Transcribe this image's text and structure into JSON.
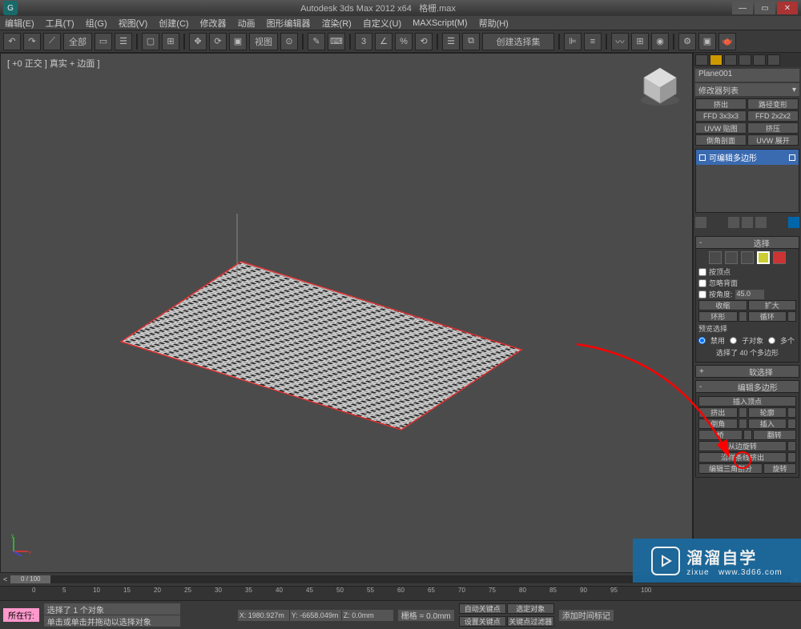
{
  "titlebar": {
    "app": "Autodesk 3ds Max  2012 x64",
    "file": "格栅.max",
    "logo": "G"
  },
  "menu": [
    "编辑(E)",
    "工具(T)",
    "组(G)",
    "视图(V)",
    "创建(C)",
    "修改器",
    "动画",
    "图形编辑器",
    "渲染(R)",
    "自定义(U)",
    "MAXScript(M)",
    "帮助(H)"
  ],
  "toolbar": {
    "scope": "全部",
    "viewbtn": "视图",
    "createset": "创建选择集"
  },
  "viewport": {
    "label": "[ +0 正交 ] 真实 + 边面 ]"
  },
  "panel": {
    "object": "Plane001",
    "modifier_list": "修改器列表",
    "quick_mods": [
      "挤出",
      "路径变形",
      "FFD 3x3x3",
      "FFD 2x2x2",
      "UVW 贴图",
      "挤压",
      "倒角剖面",
      "UVW 展开"
    ],
    "stack_item": "可编辑多边形",
    "roll_select": {
      "title": "选择",
      "by_vertex": "按顶点",
      "ignore_back": "忽略背面",
      "by_angle": "按角度:",
      "angle_val": "45.0",
      "shrink": "收缩",
      "grow": "扩大",
      "ring": "环形",
      "loop": "循环",
      "preview_label": "预览选择",
      "disable": "禁用",
      "subobj": "子对象",
      "multi": "多个",
      "count_text": "选择了 40 个多边形"
    },
    "roll_soft": "软选择",
    "roll_edit": {
      "title": "编辑多边形",
      "insert_vert": "插入顶点",
      "extrude": "挤出",
      "outline": "轮廓",
      "bevel": "倒角",
      "inset": "插入",
      "bridge": "桥",
      "flip": "翻转",
      "hinge": "从边旋转",
      "extrude_spline": "沿样条线挤出",
      "edit_tri": "编辑三角剖分",
      "turn": "旋转"
    }
  },
  "timeline": {
    "frame": "0 / 100",
    "ticks": [
      "0",
      "5",
      "10",
      "15",
      "20",
      "25",
      "30",
      "35",
      "40",
      "45",
      "50",
      "55",
      "60",
      "65",
      "70",
      "75",
      "80",
      "85",
      "90",
      "95",
      "100"
    ]
  },
  "status": {
    "sel": "选择了 1 个对象",
    "hint": "单击或单击并拖动以选择对象",
    "x": "X: 1980.927m",
    "y": "Y: -6658.049m",
    "z": "Z: 0.0mm",
    "grid": "栅格 = 0.0mm",
    "autokey": "自动关键点",
    "selset": "选定对象",
    "setkey": "设置关键点",
    "keyfilter": "关键点过滤器",
    "addtime": "添加时间标记",
    "layer": "所在行:"
  },
  "watermark": {
    "big": "溜溜自学",
    "small": "zixue",
    "url": "www.3d66.com"
  }
}
